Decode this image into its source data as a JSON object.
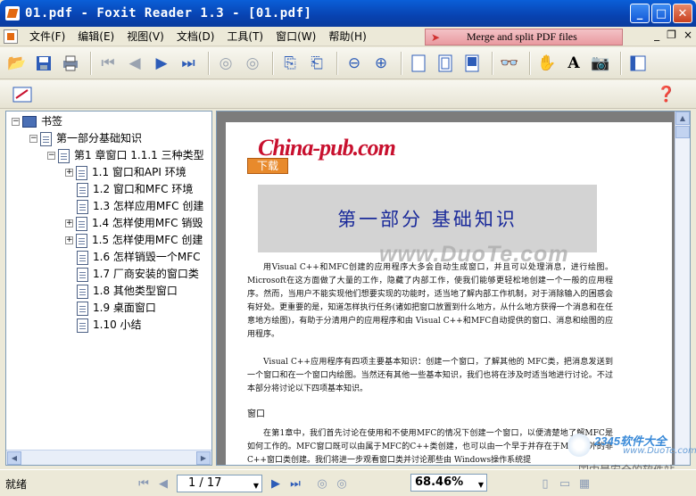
{
  "window": {
    "title": "01.pdf - Foxit Reader 1.3 - [01.pdf]",
    "minimize": "_",
    "maximize": "□",
    "close": "✕"
  },
  "menu": {
    "items": [
      "文件(F)",
      "编辑(E)",
      "视图(V)",
      "文档(D)",
      "工具(T)",
      "窗口(W)",
      "帮助(H)"
    ],
    "ad_banner": "Merge and split PDF files",
    "mdi_min": "_",
    "mdi_restore": "❐",
    "mdi_close": "×"
  },
  "toolbar": {
    "icons": [
      "open-icon",
      "save-icon",
      "print-icon",
      "first-page-icon",
      "prev-page-icon",
      "next-page-icon",
      "last-page-icon",
      "back-icon",
      "forward-icon",
      "rotate-left-icon",
      "rotate-right-icon",
      "zoom-out-icon",
      "zoom-in-icon",
      "page-icon",
      "page-fit-icon",
      "page-width-icon",
      "binoculars-icon",
      "hand-icon",
      "text-select-icon",
      "snapshot-icon",
      "layout-icon"
    ],
    "help_icon": "help-icon"
  },
  "bookmarks": {
    "root": "书签",
    "part": "第一部分基础知识",
    "chapter": "第1 章窗口 1.1.1 三种类型",
    "items": [
      {
        "label": "1.1 窗口和API 环境",
        "expandable": true
      },
      {
        "label": "1.2 窗口和MFC 环境",
        "expandable": false
      },
      {
        "label": "1.3 怎样应用MFC 创建",
        "expandable": false
      },
      {
        "label": "1.4 怎样使用MFC 销毁",
        "expandable": true
      },
      {
        "label": "1.5 怎样使用MFC 创建",
        "expandable": true
      },
      {
        "label": "1.6 怎样销毁一个MFC",
        "expandable": false
      },
      {
        "label": "1.7 厂商安装的窗口类",
        "expandable": false
      },
      {
        "label": "1.8 其他类型窗口",
        "expandable": false
      },
      {
        "label": "1.9 桌面窗口",
        "expandable": false
      },
      {
        "label": "1.10 小结",
        "expandable": false
      }
    ]
  },
  "document": {
    "logo": "China-pub.com",
    "download": "下载",
    "part_title": "第一部分  基础知识",
    "watermark": "www.DuoTe.com",
    "para1": "用Visual C++和MFC创建的应用程序大多会自动生成窗口，并且可以处理消息，进行绘图。Microsoft在这方面做了大量的工作，隐藏了内部工作，使我们能够更轻松地创建一个一般的应用程序。然而，当用户不能实现他们想要实现的功能时，适当地了解内部工作机制，对于消除输入的困惑会有好处。更重要的是，知道怎样执行任务(诸如把窗口放置到什么地方，从什么地方获得一个消息和在任意地方绘图)，有助于分清用户的应用程序和由 Visual C++和MFC自动提供的窗口、消息和绘图的应用程序。",
    "para2": "Visual C++应用程序有四项主要基本知识：创建一个窗口，了解其他的 MFC类，把消息发送到一个窗口和在一个窗口内绘图。当然还有其他一些基本知识，我们也将在涉及时适当地进行讨论。不过本部分将讨论以下四项基本知识。",
    "section": "窗口",
    "para3": "在第1章中，我们首先讨论在使用和不使用MFC的情况下创建一个窗口，以便清楚地了解MFC是如何工作的。MFC窗口既可以由属于MFC的C++类创建，也可以由一个早于并存在于MFC之外的非C++窗口类创建。我们将进一步观看窗口类并讨论那些由 Windows操作系统提"
  },
  "corner_watermark": {
    "brand": "2345软件大全",
    "url": "www.DuoTe.com",
    "slogan": "国内最安全的软件站"
  },
  "status": {
    "text": "就绪",
    "page": "1 / 17",
    "zoom": "68.46%"
  }
}
